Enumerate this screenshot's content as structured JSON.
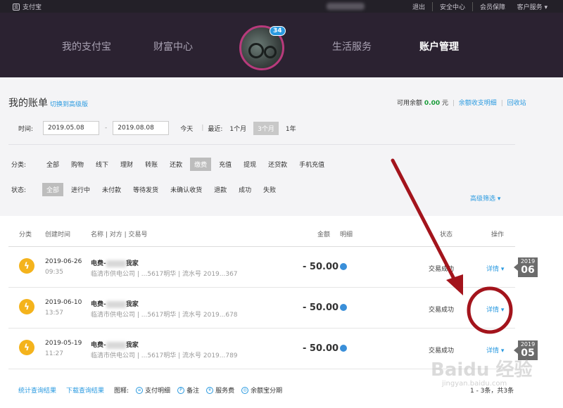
{
  "topbar": {
    "brand": "支付宝",
    "links": [
      "退出",
      "安全中心",
      "会员保障"
    ],
    "service": "客户服务 ▾"
  },
  "nav": {
    "items": [
      "我的支付宝",
      "财富中心",
      "生活服务",
      "账户管理"
    ],
    "badge": "34"
  },
  "bill": {
    "title": "我的账单",
    "switch": "切换到高级版",
    "balance_label": "可用余额",
    "balance_value": "0.00",
    "balance_unit": "元",
    "balance_link1": "余额收支明细",
    "balance_link2": "回收站"
  },
  "time_filter": {
    "label": "时间:",
    "start": "2019.05.08",
    "end": "2019.08.08",
    "today": "今天",
    "recent": "最近:",
    "opts": [
      "1个月",
      "3个月",
      "1年"
    ]
  },
  "category": {
    "label": "分类:",
    "items": [
      "全部",
      "购物",
      "线下",
      "理财",
      "转账",
      "还款",
      "缴费",
      "充值",
      "提现",
      "还贷款",
      "手机充值"
    ]
  },
  "status_filter": {
    "label": "状态:",
    "items": [
      "全部",
      "进行中",
      "未付款",
      "等待发货",
      "未确认收货",
      "退款",
      "成功",
      "失败"
    ]
  },
  "advanced": "高级筛选 ▾",
  "table": {
    "headers": [
      "分类",
      "创建时间",
      "名称 | 对方 | 交易号",
      "金额",
      "明细",
      "状态",
      "操作"
    ],
    "rows": [
      {
        "date": "2019-06-26",
        "time": "09:35",
        "name_pre": "电费-",
        "name_post": "我家",
        "sub_pre": "临清市供电公司 | ...5617",
        "sub_post": "明华 | 流水号 2019...367",
        "amount": "- 50.00",
        "status": "交易成功",
        "op": "详情 ▾"
      },
      {
        "date": "2019-06-10",
        "time": "13:57",
        "name_pre": "电费-",
        "name_post": "我家",
        "sub_pre": "临清市供电公司 | ...5617",
        "sub_post": "明华 | 流水号 2019...678",
        "amount": "- 50.00",
        "status": "交易成功",
        "op": "详情 ▾"
      },
      {
        "date": "2019-05-19",
        "time": "11:27",
        "name_pre": "电费-",
        "name_post": "我家",
        "sub_pre": "临清市供电公司 | ...5617",
        "sub_post": "明华 | 流水号 2019...789",
        "amount": "- 50.00",
        "status": "交易成功",
        "op": "详情 ▾"
      }
    ]
  },
  "month_tags": [
    {
      "year": "2019",
      "month": "06"
    },
    {
      "year": "2019",
      "month": "05"
    }
  ],
  "footer": {
    "link1": "统计查询结果",
    "link2": "下载查询结果",
    "legend_label": "图释:",
    "legend": [
      "支付明细",
      "备注",
      "服务费",
      "余额宝分期"
    ],
    "page": "1 - 3条，共3条"
  },
  "watermark": "Baidu 经验",
  "watermark_sub": "jingyan.baidu.com"
}
